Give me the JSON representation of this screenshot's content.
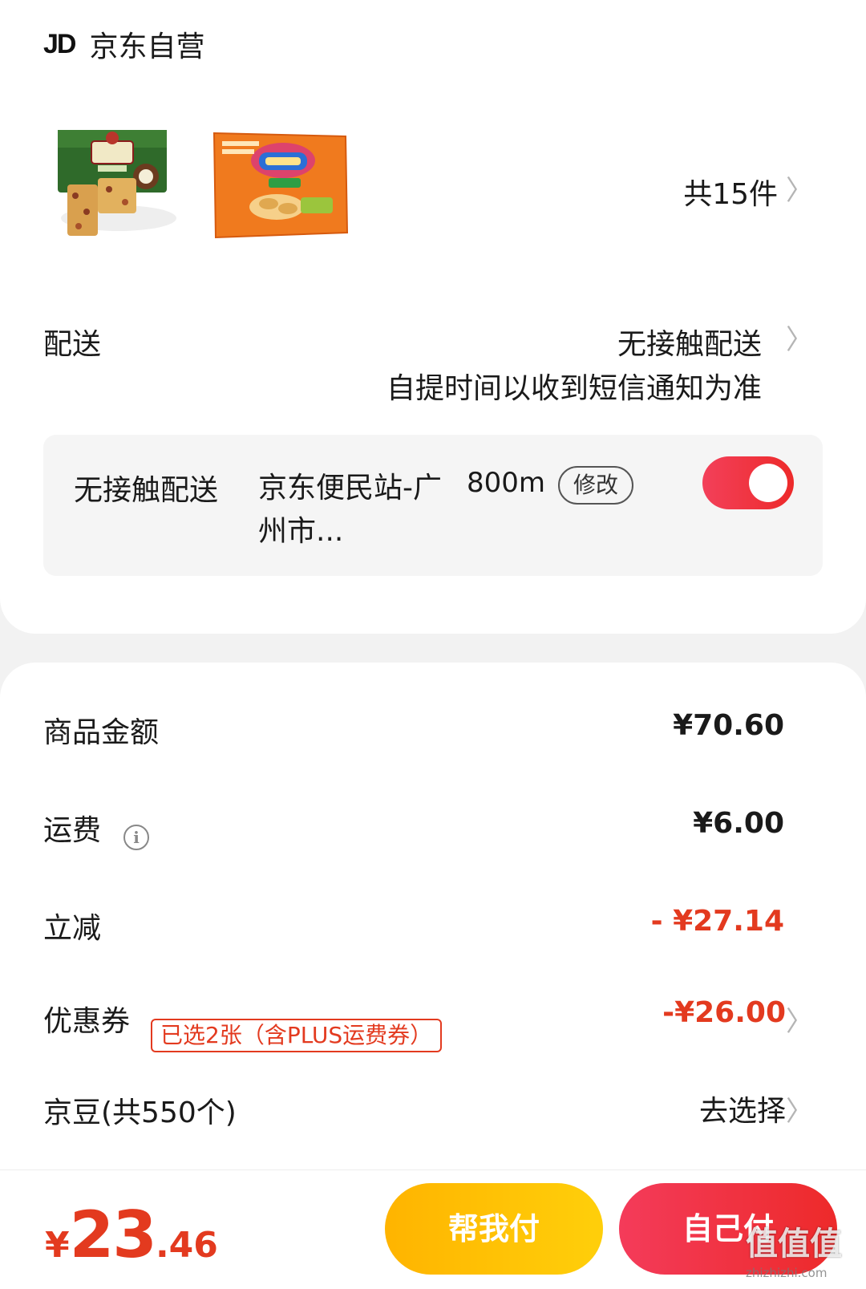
{
  "shop": {
    "logo": "JD",
    "name": "京东自营",
    "item_count": "共15件"
  },
  "delivery": {
    "label": "配送",
    "method": "无接触配送",
    "note": "自提时间以收到短信通知为准",
    "pickup": {
      "type": "无接触配送",
      "station": "京东便民站-广州市...",
      "distance": "800m",
      "edit_label": "修改",
      "enabled": true
    }
  },
  "price": {
    "subtotal_label": "商品金额",
    "subtotal_value": "¥70.60",
    "shipping_label": "运费",
    "shipping_value": "¥6.00",
    "discount_label": "立减",
    "discount_value": "- ¥27.14",
    "coupon_label": "优惠券",
    "coupon_tag": "已选2张（含PLUS运费券）",
    "coupon_value": "-¥26.00",
    "beans_label": "京豆(共550个)",
    "beans_value": "去选择"
  },
  "footer": {
    "currency": "¥",
    "total_int": "23",
    "total_dec": ".46",
    "help_pay": "帮我付",
    "self_pay": "自己付"
  },
  "watermark": {
    "text": "值值值",
    "url": "zhizhizhi.com"
  },
  "colors": {
    "accent_red": "#e33a1f",
    "toggle_red": "#f03a4e",
    "help_yellow": "#ffc107"
  }
}
